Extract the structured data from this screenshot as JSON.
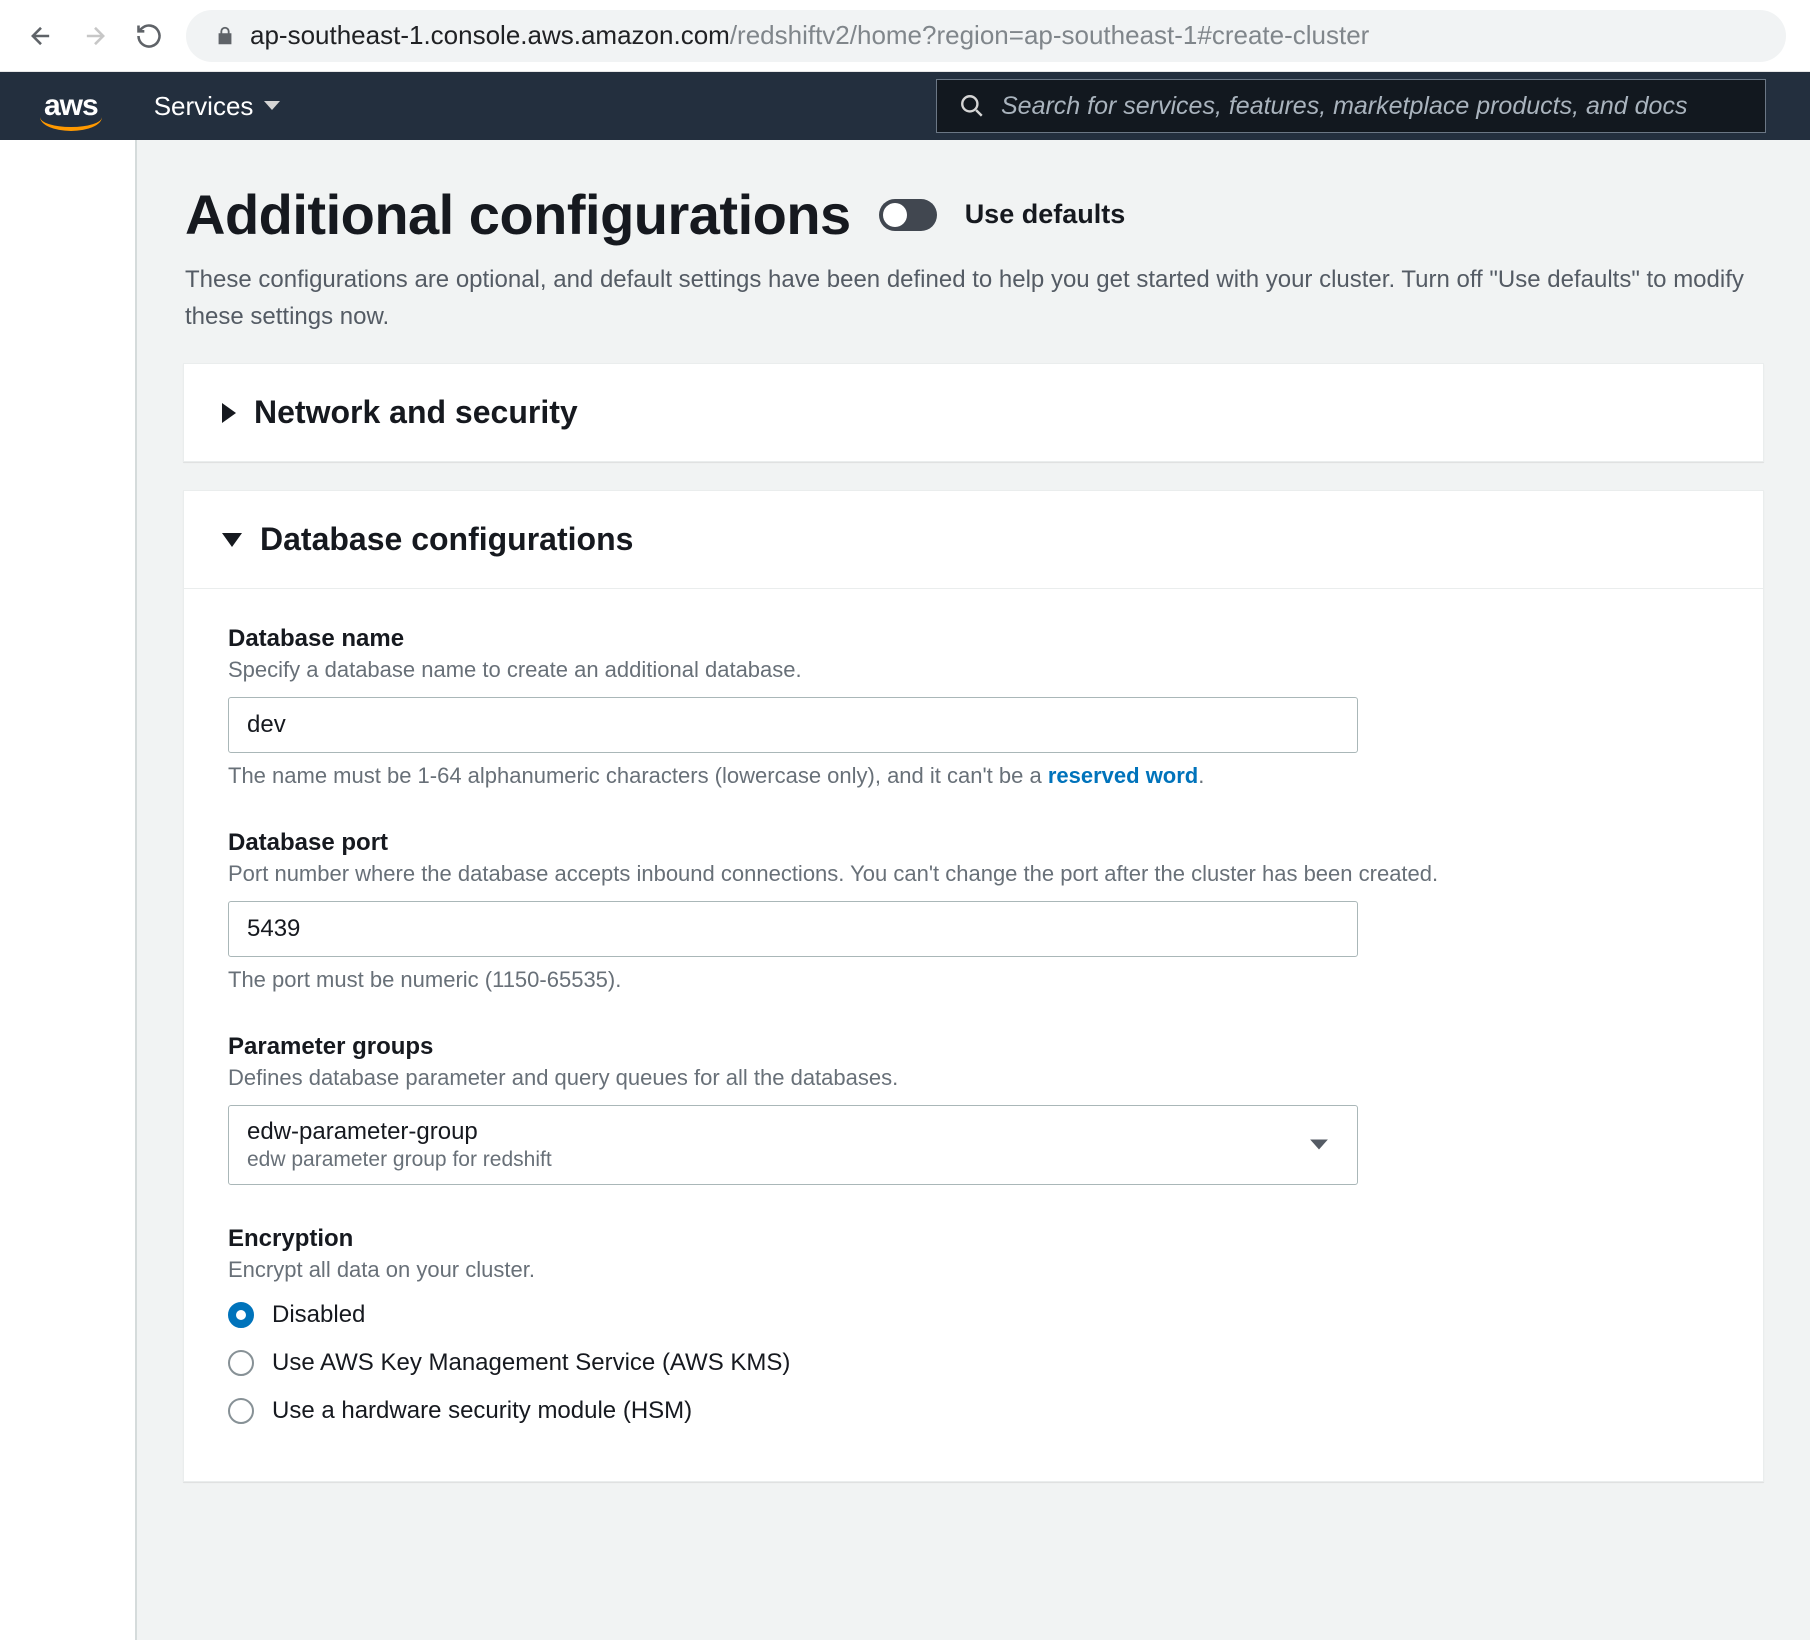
{
  "browser": {
    "url_host": "ap-southeast-1.console.aws.amazon.com",
    "url_path": "/redshiftv2/home?region=ap-southeast-1#create-cluster"
  },
  "nav": {
    "logo_text": "aws",
    "services_label": "Services",
    "search_placeholder": "Search for services, features, marketplace products, and docs"
  },
  "header": {
    "title": "Additional configurations",
    "toggle_label": "Use defaults",
    "description": "These configurations are optional, and default settings have been defined to help you get started with your cluster. Turn off \"Use defaults\" to modify these settings now."
  },
  "panels": {
    "network": {
      "title": "Network and security"
    },
    "database": {
      "title": "Database configurations",
      "db_name": {
        "label": "Database name",
        "hint": "Specify a database name to create an additional database.",
        "value": "dev",
        "help_pre": "The name must be 1-64 alphanumeric characters (lowercase only), and it can't be a ",
        "help_link": "reserved word",
        "help_post": "."
      },
      "db_port": {
        "label": "Database port",
        "hint": "Port number where the database accepts inbound connections. You can't change the port after the cluster has been created.",
        "value": "5439",
        "help": "The port must be numeric (1150-65535)."
      },
      "param_groups": {
        "label": "Parameter groups",
        "hint": "Defines database parameter and query queues for all the databases.",
        "selected": "edw-parameter-group",
        "selected_desc": "edw parameter group for redshift"
      },
      "encryption": {
        "label": "Encryption",
        "hint": "Encrypt all data on your cluster.",
        "options": [
          "Disabled",
          "Use AWS Key Management Service (AWS KMS)",
          "Use a hardware security module (HSM)"
        ],
        "selected_index": 0
      }
    }
  }
}
